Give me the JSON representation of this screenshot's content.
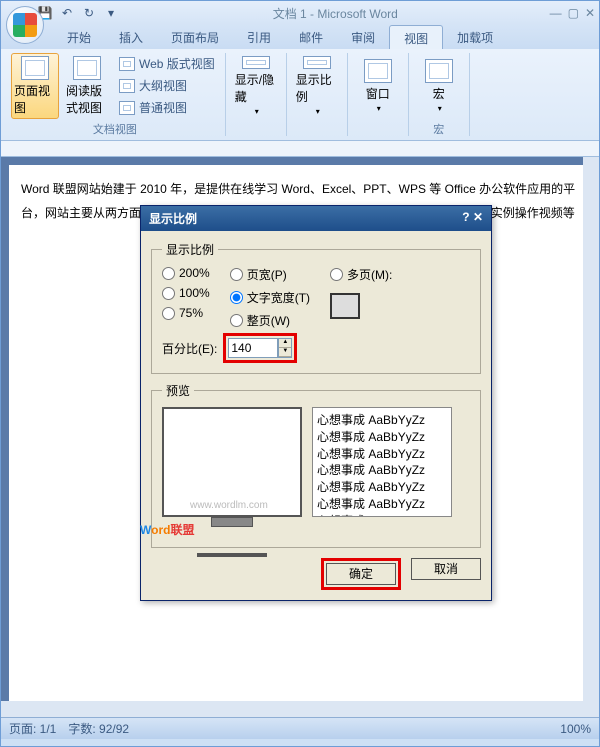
{
  "title": "文档 1 - Microsoft Word",
  "tabs": [
    "开始",
    "插入",
    "页面布局",
    "引用",
    "邮件",
    "审阅",
    "视图",
    "加载项"
  ],
  "activeTab": "视图",
  "ribbon": {
    "group1": {
      "label": "文档视图",
      "btns": [
        "页面视图",
        "阅读版式视图",
        "Web 版式视图",
        "大纲视图",
        "普通视图"
      ]
    },
    "group2": {
      "label": "",
      "btn": "显示/隐藏"
    },
    "group3": {
      "label": "",
      "btn": "显示比例"
    },
    "group4": {
      "label": "",
      "btn": "窗口"
    },
    "group5": {
      "label": "宏",
      "btn": "宏"
    }
  },
  "doc_text": "Word 联盟网站始建于 2010 年，是提供在线学习 Word、Excel、PPT、WPS 等 Office 办公软件应用的平台，网站主要从两方面入手：第一，分享原创 Office 办公软件操作技巧文章；第二，入门实例操作视频等",
  "modal": {
    "title": "显示比例",
    "group_title": "显示比例",
    "radios_left": [
      "200%",
      "100%",
      "75%"
    ],
    "radios_mid": [
      "页宽(P)",
      "文字宽度(T)",
      "整页(W)"
    ],
    "radios_right": "多页(M):",
    "selected": "文字宽度(T)",
    "pct_label": "百分比(E):",
    "pct_value": "140",
    "preview_label": "预览",
    "sample_line": "心想事成 AaBbYyZz",
    "ok": "确定",
    "cancel": "取消"
  },
  "status": {
    "page": "页面: 1/1",
    "words": "字数: 92/92",
    "zoom": "100%"
  },
  "watermark": {
    "url": "www.wordlm.com"
  }
}
